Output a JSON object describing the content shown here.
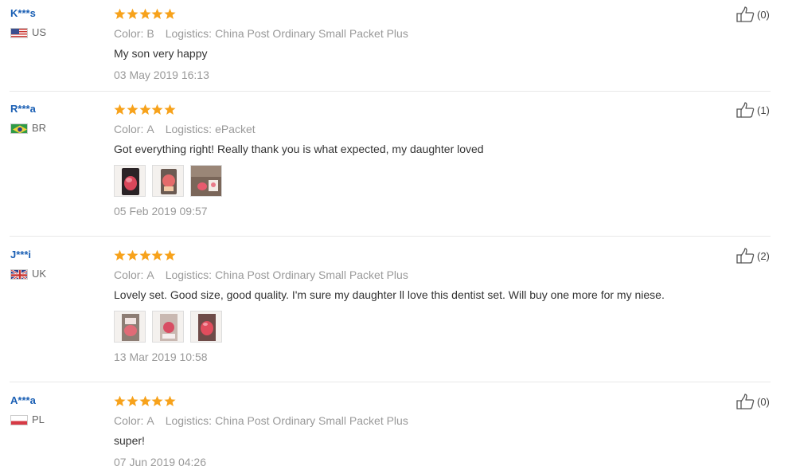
{
  "labels": {
    "color": "Color:",
    "logistics": "Logistics:"
  },
  "reviews": [
    {
      "user": "K***s",
      "country": "US",
      "flag": "us-flag-icon",
      "stars": 5,
      "color": "B",
      "logistics": "China Post Ordinary Small Packet Plus",
      "text": "My son very happy",
      "date": "03 May 2019 16:13",
      "likes": "(0)",
      "photos": 0
    },
    {
      "user": "R***a",
      "country": "BR",
      "flag": "br-flag-icon",
      "stars": 5,
      "color": "A",
      "logistics": "ePacket",
      "text": "Got everything right! Really thank you is what expected, my daughter loved",
      "date": "05 Feb 2019 09:57",
      "likes": "(1)",
      "photos": 3
    },
    {
      "user": "J***i",
      "country": "UK",
      "flag": "uk-flag-icon",
      "stars": 5,
      "color": "A",
      "logistics": "China Post Ordinary Small Packet Plus",
      "text": "Lovely set. Good size, good quality. I'm sure my daughter ll love this dentist set. Will buy one more for my niese.",
      "date": "13 Mar 2019 10:58",
      "likes": "(2)",
      "photos": 3
    },
    {
      "user": "A***a",
      "country": "PL",
      "flag": "pl-flag-icon",
      "stars": 5,
      "color": "A",
      "logistics": "China Post Ordinary Small Packet Plus",
      "text": "super!",
      "date": "07 Jun 2019 04:26",
      "likes": "(0)",
      "photos": 0
    }
  ],
  "colors": {
    "star": "#f7a21b",
    "username": "#1a5fb4",
    "muted": "#999999"
  }
}
